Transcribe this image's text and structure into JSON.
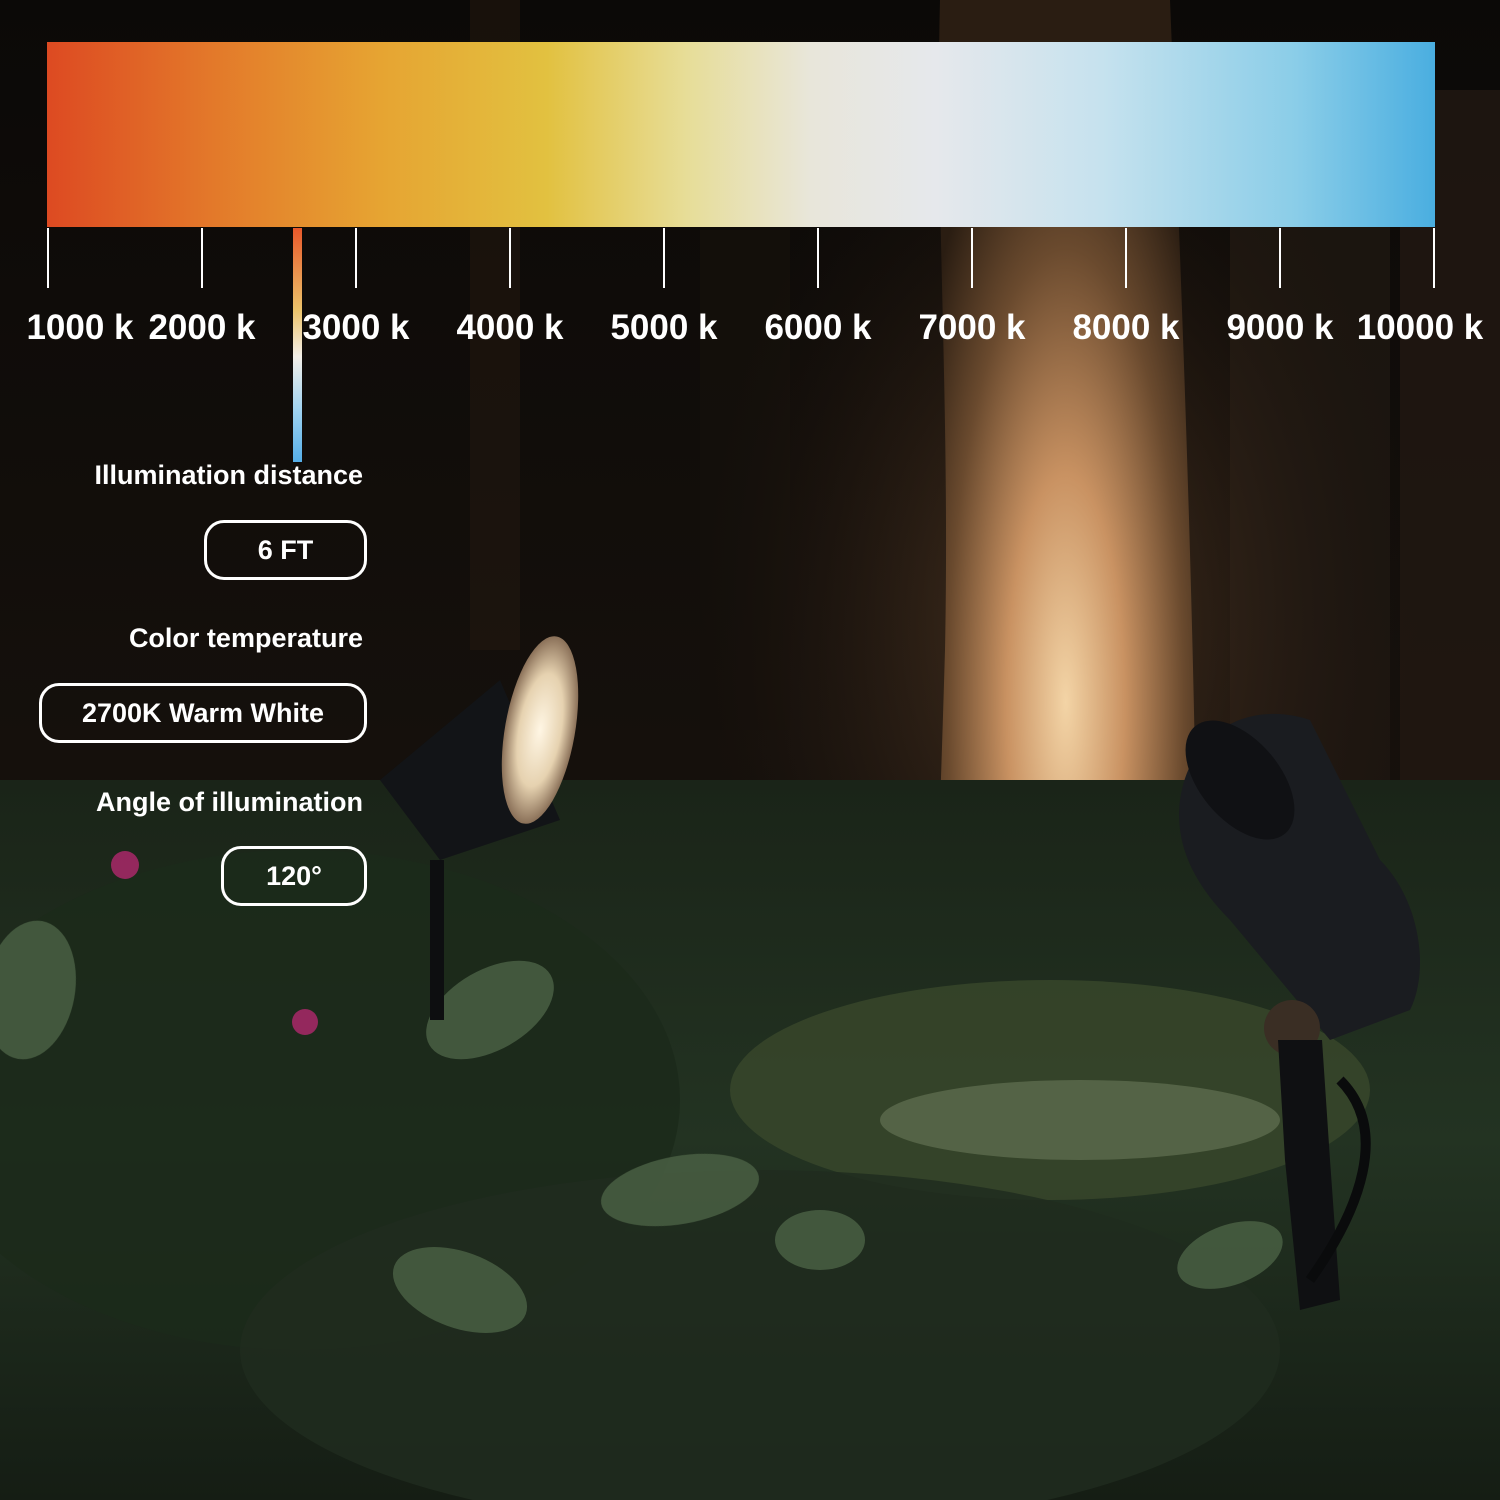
{
  "scale": {
    "ticks": [
      {
        "label": "1000 k"
      },
      {
        "label": "2000 k"
      },
      {
        "label": "3000 k"
      },
      {
        "label": "4000 k"
      },
      {
        "label": "5000 k"
      },
      {
        "label": "6000 k"
      },
      {
        "label": "7000 k"
      },
      {
        "label": "8000 k"
      },
      {
        "label": "9000 k"
      },
      {
        "label": "10000 k"
      }
    ],
    "gradient_colors": [
      "#dd4a22",
      "#e6a432",
      "#e2c140",
      "#e8e6da",
      "#8acde8",
      "#4aaee0"
    ],
    "marker_value_k": 2700
  },
  "specs": {
    "distance": {
      "label": "Illumination distance",
      "value": "6 FT"
    },
    "color_temp": {
      "label": "Color temperature",
      "value": "2700K Warm White"
    },
    "angle": {
      "label": "Angle of illumination",
      "value": "120°"
    }
  },
  "scene": {
    "icons": [
      "spotlight-left",
      "spotlight-right",
      "tree-trunk",
      "foliage"
    ]
  }
}
